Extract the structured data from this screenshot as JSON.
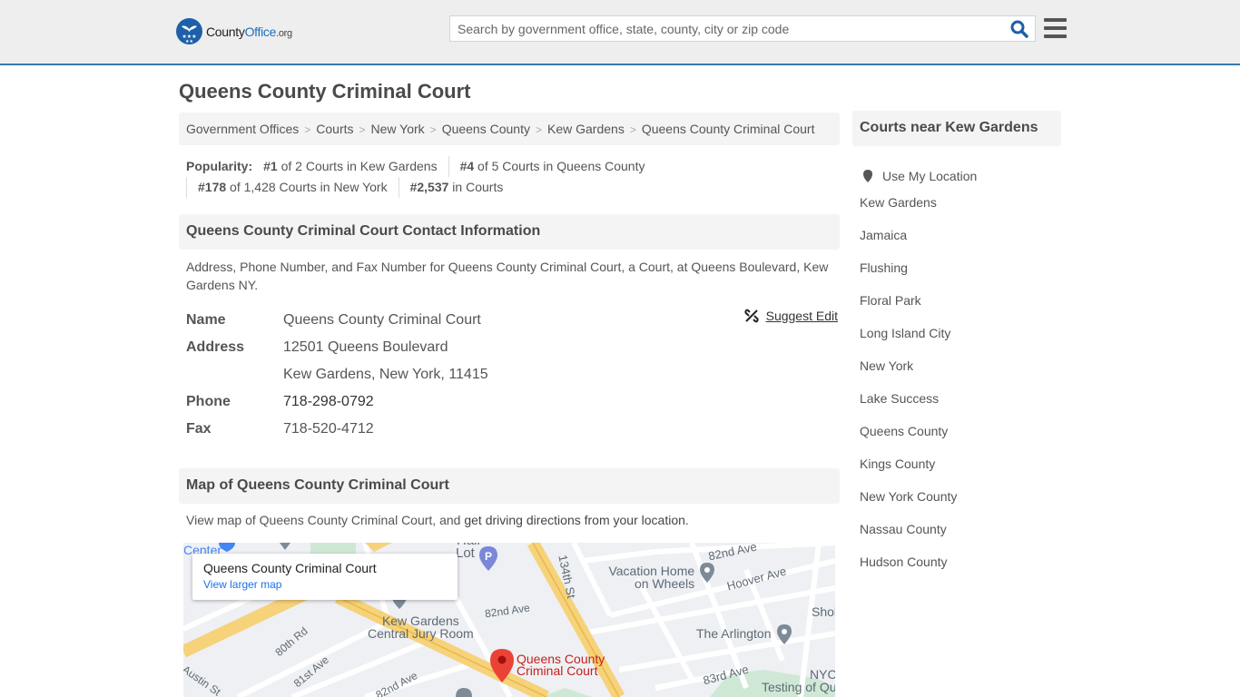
{
  "header": {
    "logo": {
      "county": "County",
      "office": "Office",
      "org": ".org"
    },
    "search_placeholder": "Search by government office, state, county, city or zip code",
    "search_icon": "search-icon",
    "menu_icon": "hamburger-menu-icon"
  },
  "page": {
    "title": "Queens County Criminal Court"
  },
  "breadcrumb": [
    {
      "label": "Government Offices"
    },
    {
      "label": "Courts"
    },
    {
      "label": "New York"
    },
    {
      "label": "Queens County"
    },
    {
      "label": "Kew Gardens"
    },
    {
      "label": "Queens County Criminal Court"
    }
  ],
  "popularity": {
    "label": "Popularity:",
    "items": [
      {
        "rank": "#1",
        "text": " of 2 Courts in Kew Gardens"
      },
      {
        "rank": "#4",
        "text": " of 5 Courts in Queens County"
      },
      {
        "rank": "#178",
        "text": " of 1,428 Courts in New York"
      },
      {
        "rank": "#2,537",
        "text": " in Courts"
      }
    ]
  },
  "contact": {
    "heading": "Queens County Criminal Court Contact Information",
    "description": "Address, Phone Number, and Fax Number for Queens County Criminal Court, a Court, at Queens Boulevard, Kew Gardens NY.",
    "suggest_edit": "Suggest Edit",
    "fields": {
      "name_label": "Name",
      "name_value": "Queens County Criminal Court",
      "address_label": "Address",
      "address_line1": "12501 Queens Boulevard",
      "address_line2": "Kew Gardens, New York, 11415",
      "phone_label": "Phone",
      "phone_value": "718-298-0792",
      "fax_label": "Fax",
      "fax_value": "718-520-4712"
    }
  },
  "map_section": {
    "heading": "Map of Queens County Criminal Court",
    "text_before": "View map of Queens County Criminal Court, and ",
    "directions_link": "get driving directions from your location",
    "text_after": ".",
    "card_title": "Queens County Criminal Court",
    "card_link": "View larger map",
    "pin_label_line1": "Queens County",
    "pin_label_line2": "Criminal Court",
    "labels": {
      "center": "Center",
      "borough_hall": "Queens Borough Hall",
      "lot": "Lot",
      "st134": "134th St",
      "ave82_top": "82nd Ave",
      "vacation1": "Vacation Home",
      "vacation2": "on Wheels",
      "hoover": "Hoover Ave",
      "shol": "Shol",
      "kew1": "Kew Gardens",
      "kew2": "Central Jury Room",
      "ave82_mid": "82nd Ave",
      "arlington": "The Arlington",
      "rd80": "80th Rd",
      "ave81": "81st Ave",
      "ave82_low": "82nd Ave",
      "ave83": "83rd Ave",
      "austin": "Austin St",
      "nyc": "NYC",
      "testing": "Testing of Qu"
    }
  },
  "sidebar": {
    "heading": "Courts near Kew Gardens",
    "use_location": "Use My Location",
    "links": [
      "Kew Gardens",
      "Jamaica",
      "Flushing",
      "Floral Park",
      "Long Island City",
      "New York",
      "Lake Success",
      "Queens County",
      "Kings County",
      "New York County",
      "Nassau County",
      "Hudson County"
    ]
  },
  "colors": {
    "accent_blue": "#3a78b0",
    "logo_blue": "#1d5fa8",
    "map_pin_red": "#ea4335"
  }
}
